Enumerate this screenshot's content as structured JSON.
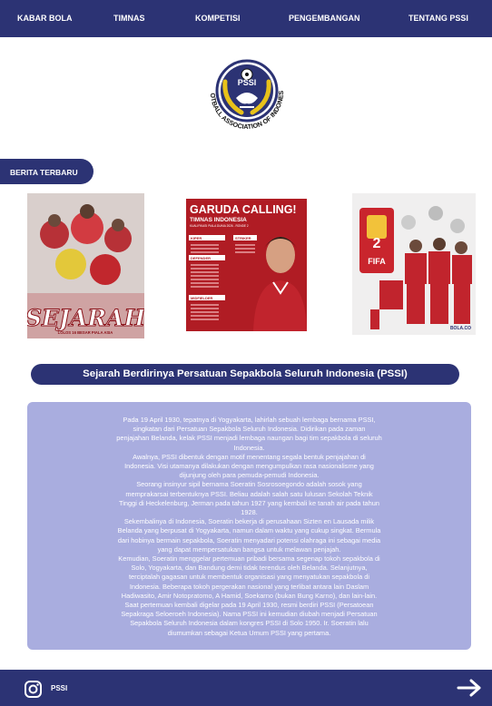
{
  "nav": {
    "items": [
      "KABAR BOLA",
      "TIMNAS",
      "KOMPETISI",
      "PENGEMBANGAN",
      "TENTANG PSSI"
    ]
  },
  "logo": {
    "abbr": "PSSI",
    "ring_text": "FOOTBALL ASSOCIATION OF INDONESIA",
    "icon": "pssi-emblem-icon"
  },
  "news": {
    "tab_label": "BERITA TERBARU",
    "cards": [
      {
        "headline": "SEJARAH",
        "subline": "LOLOS 16 BESAR PIALA ASIA"
      },
      {
        "headline": "GARUDA CALLING!",
        "subline": "TIMNAS INDONESIA",
        "tag": "KUALIFIKASI PIALA DUNIA 2026 - RONDE 2",
        "groups": [
          "KIPER",
          "STRIKER",
          "DEFENDER",
          "MIDFIELDER"
        ]
      },
      {
        "headline": "FIFA",
        "tag": "BOLA.CO"
      }
    ]
  },
  "article": {
    "title": "Sejarah Berdirinya Persatuan Sepakbola Seluruh Indonesia (PSSI)",
    "lines": [
      "Pada 19 April 1930, tepatnya di Yogyakarta, lahirlah sebuah lembaga bernama PSSI,",
      "singkatan dari Persatuan Sepakbola Seluruh Indonesia. Didirikan pada zaman",
      "penjajahan Belanda, kelak PSSI menjadi lembaga naungan bagi tim sepakbola di seluruh",
      "Indonesia.",
      "Awalnya, PSSI dibentuk dengan motif menentang segala bentuk penjajahan di",
      "Indonesia. Visi utamanya dilakukan dengan mengumpulkan rasa nasionalisme yang",
      "dijunjung oleh para pemuda-pemudi Indonesia.",
      "Seorang insinyur sipil bernama Soeratin Sosrosoegondo adalah sosok yang",
      "memprakarsai terbentuknya PSSI. Beliau adalah salah satu lulusan Sekolah Teknik",
      "Tinggi di Heckelenburg, Jerman pada tahun 1927 yang kembali ke tanah air pada tahun",
      "1928.",
      "Sekembalinya di Indonesia, Soeratin bekerja di perusahaan Sizten en Lausada milik",
      "Belanda yang berpusat di Yogyakarta, namun dalam waktu yang cukup singkat. Bermula",
      "dari hobinya bermain sepakbola, Soeratin menyadari potensi olahraga ini sebagai media",
      "yang dapat mempersatukan bangsa untuk melawan penjajah.",
      "Kemudian, Soeratin menggelar pertemuan pribadi bersama segenap tokoh sepakbola di",
      "Solo, Yogyakarta, dan Bandung demi tidak terendus oleh Belanda. Selanjutnya,",
      "terciptalah gagasan untuk membentuk organisasi yang menyatukan sepakbola di",
      "Indonesia. Beberapa tokoh pergerakan nasional yang terlibat antara lain Daslam",
      "Hadiwasito, Amir Notopratomo, A Hamid, Soekarno (bukan Bung Karno), dan lain-lain.",
      "Saat pertemuan kembali digelar pada 19 April 1930, resmi berdiri PSSI (Persatoean",
      "Sepakraga Seloeroeh Indonesia). Nama PSSI ini kemudian diubah menjadi Persatuan",
      "Sepakbola Seluruh Indonesia dalam kongres PSSI di Solo 1950. Ir. Soeratin lalu",
      "diumumkan sebagai Ketua Umum PSSI yang pertama."
    ]
  },
  "footer": {
    "label": "PSSI",
    "social_icon": "instagram-icon",
    "next_icon": "arrow-right-icon"
  },
  "colors": {
    "navy": "#2c3374",
    "lavender": "#a9addf",
    "gold": "#e8c21a",
    "red": "#c7202a"
  }
}
